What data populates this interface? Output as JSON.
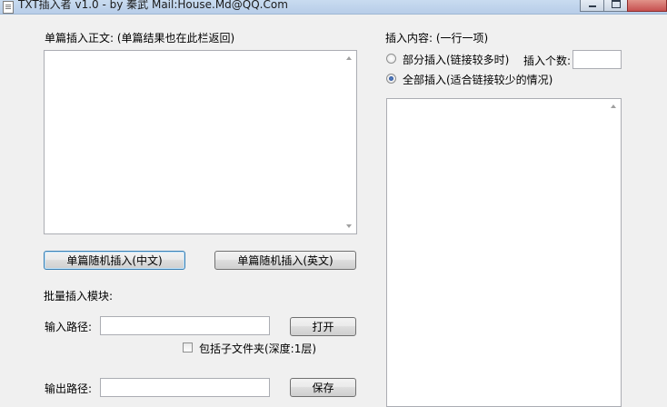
{
  "window": {
    "title": "TXT插入者 v1.0 - by 秦武 Mail:House.Md@QQ.Com"
  },
  "single": {
    "label": "单篇插入正文: (单篇结果也在此栏返回)",
    "content": "",
    "btn_cn": "单篇随机插入(中文)",
    "btn_en": "单篇随机插入(英文)"
  },
  "batch": {
    "label": "批量插入模块:",
    "input_path_label": "输入路径:",
    "input_path_value": "",
    "open_button": "打开",
    "subfolder_label": "包括子文件夹(深度:1层)",
    "output_path_label": "输出路径:",
    "output_path_value": "",
    "save_button": "保存"
  },
  "insert": {
    "label": "插入内容: (一行一项)",
    "partial_label": "部分插入(链接较多时)",
    "count_label": "插入个数:",
    "count_value": "",
    "full_label": "全部插入(适合链接较少的情况)",
    "content": ""
  }
}
